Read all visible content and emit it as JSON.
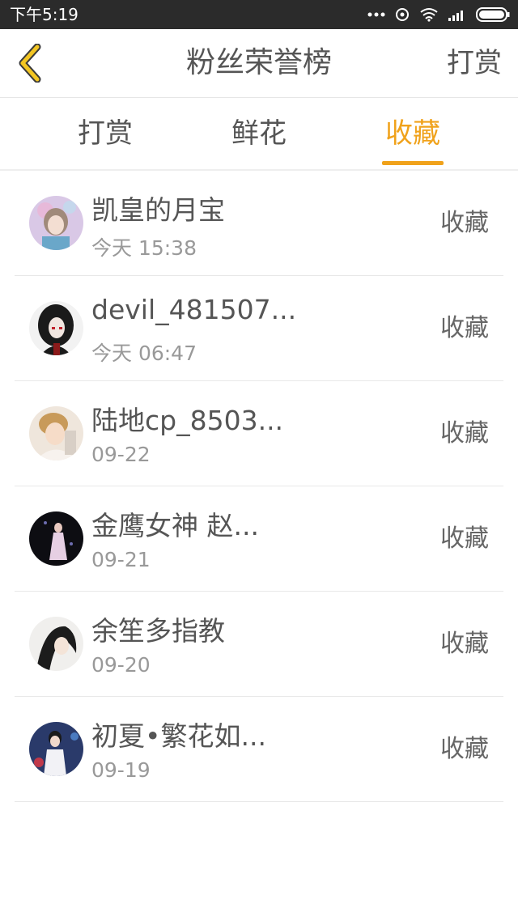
{
  "status_bar": {
    "time": "下午5:19"
  },
  "header": {
    "title": "粉丝荣誉榜",
    "right_action": "打赏"
  },
  "tabs": [
    {
      "label": "打赏",
      "active": false
    },
    {
      "label": "鲜花",
      "active": false
    },
    {
      "label": "收藏",
      "active": true
    }
  ],
  "colors": {
    "accent": "#f0a21b",
    "text": "#555555",
    "subtext": "#999999"
  },
  "rows": [
    {
      "name": "凯皇的月宝",
      "time": "今天 15:38",
      "action": "收藏"
    },
    {
      "name": "devil_481507...",
      "time": "今天 06:47",
      "action": "收藏"
    },
    {
      "name": "陆地cp_8503...",
      "time": "09-22",
      "action": "收藏"
    },
    {
      "name": "金鹰女神 赵...",
      "time": "09-21",
      "action": "收藏"
    },
    {
      "name": "余笙多指教",
      "time": "09-20",
      "action": "收藏"
    },
    {
      "name": "初夏•繁花如...",
      "time": "09-19",
      "action": "收藏"
    }
  ]
}
